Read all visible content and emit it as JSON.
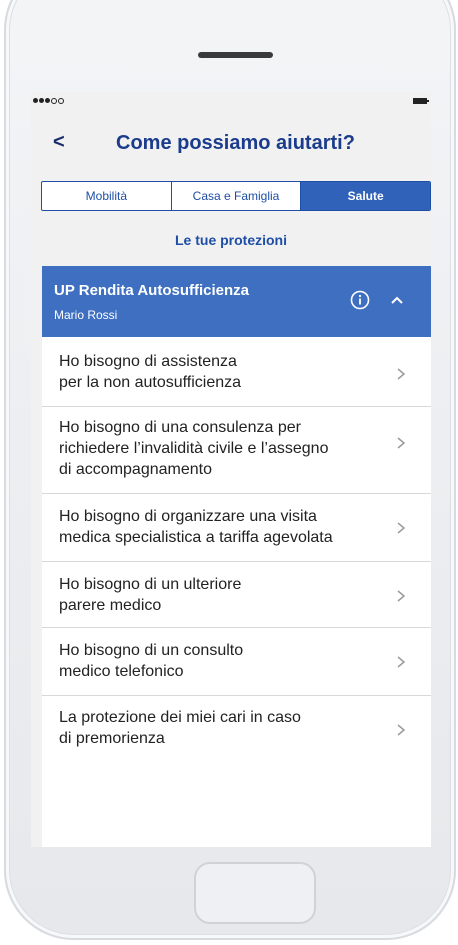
{
  "header": {
    "back_symbol": "<",
    "title": "Come possiamo aiutarti?"
  },
  "tabs": [
    {
      "label": "Mobilità",
      "active": false
    },
    {
      "label": "Casa e Famiglia",
      "active": false
    },
    {
      "label": "Salute",
      "active": true
    }
  ],
  "section_title": "Le tue protezioni",
  "card": {
    "title": "UP Rendita Autosufficienza",
    "subtitle": "Mario Rossi",
    "info_icon": "info-circle",
    "collapse_icon": "chevron-up"
  },
  "items": [
    {
      "label": "Ho bisogno di assistenza\nper la non autosufficienza"
    },
    {
      "label": "Ho bisogno di una consulenza per\nrichiedere l’invalidità civile e l’assegno\ndi accompagnamento"
    },
    {
      "label": "Ho bisogno di organizzare una visita\nmedica specialistica a tariffa agevolata"
    },
    {
      "label": "Ho bisogno di un ulteriore\nparere medico"
    },
    {
      "label": "Ho bisogno di un consulto\nmedico telefonico"
    },
    {
      "label": "La protezione dei miei cari in caso\ndi premorienza"
    }
  ],
  "colors": {
    "brand_blue": "#1f4ea6",
    "card_blue": "#3f6fc0",
    "title_blue": "#1b3c8c"
  }
}
